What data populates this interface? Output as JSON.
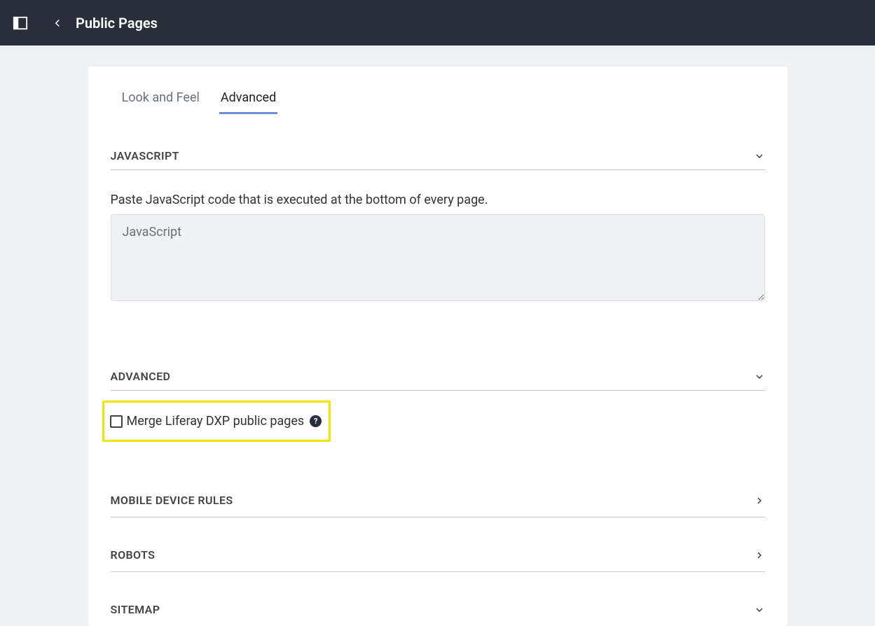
{
  "header": {
    "title": "Public Pages"
  },
  "tabs": {
    "look_and_feel": "Look and Feel",
    "advanced": "Advanced",
    "active": "advanced"
  },
  "sections": {
    "javascript": {
      "title": "JAVASCRIPT",
      "description": "Paste JavaScript code that is executed at the bottom of every page.",
      "placeholder": "JavaScript"
    },
    "advanced": {
      "title": "ADVANCED",
      "checkbox_label": "Merge Liferay DXP public pages"
    },
    "mobile_device_rules": {
      "title": "MOBILE DEVICE RULES"
    },
    "robots": {
      "title": "ROBOTS"
    },
    "sitemap": {
      "title": "SITEMAP"
    }
  }
}
